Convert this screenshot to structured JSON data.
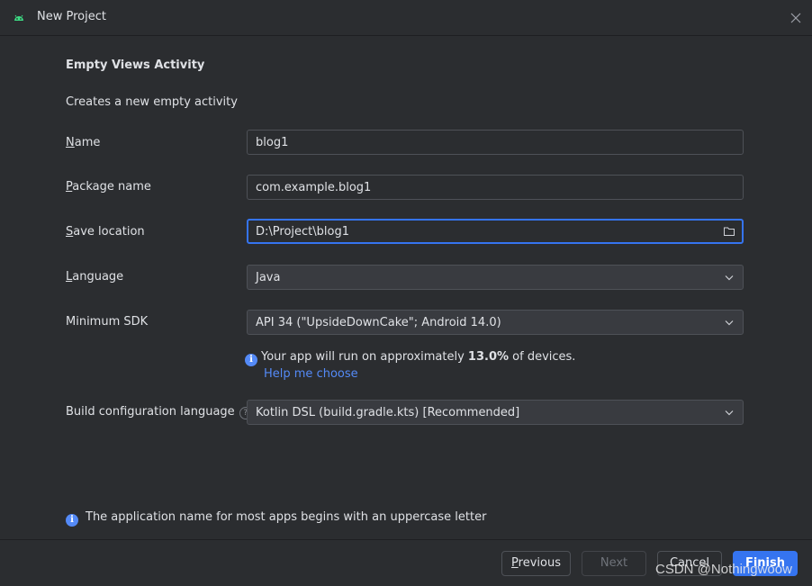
{
  "window": {
    "title": "New Project",
    "accent": "#3574f0",
    "link_color": "#548af7"
  },
  "page": {
    "heading": "Empty Views Activity",
    "description": "Creates a new empty activity"
  },
  "form": {
    "name": {
      "mnemonic": "N",
      "label_rest": "ame",
      "value": "blog1"
    },
    "package": {
      "mnemonic": "P",
      "label_rest": "ackage name",
      "value": "com.example.blog1"
    },
    "save_location": {
      "mnemonic": "S",
      "label_rest": "ave location",
      "value": "D:\\Project\\blog1",
      "icon": "folder-icon"
    },
    "language": {
      "mnemonic": "L",
      "label_rest": "anguage",
      "value": "Java"
    },
    "min_sdk": {
      "label": "Minimum SDK",
      "value": "API 34 (\"UpsideDownCake\"; Android 14.0)"
    },
    "build_lang": {
      "label": "Build configuration language",
      "help_glyph": "?",
      "value": "Kotlin DSL (build.gradle.kts) [Recommended]"
    }
  },
  "sdk_info": {
    "prefix": "Your app will run on approximately ",
    "percent": "13.0%",
    "suffix": " of devices.",
    "link": "Help me choose"
  },
  "bottom_note": "The application name for most apps begins with an uppercase letter",
  "buttons": {
    "previous": {
      "mnemonic": "P",
      "rest": "revious"
    },
    "next": "Next",
    "cancel": "Cancel",
    "finish": "Finish"
  },
  "watermark": "CSDN @Nothingwoow"
}
